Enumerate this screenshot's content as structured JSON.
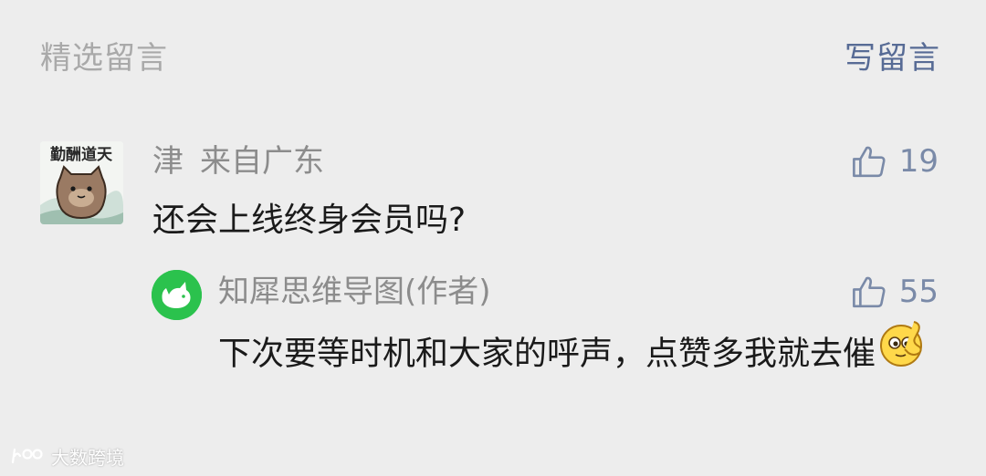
{
  "header": {
    "title": "精选留言",
    "write_label": "写留言"
  },
  "comment": {
    "avatar_caption": "勤酬道天",
    "nickname": "津",
    "location": "来自广东",
    "likes": "19",
    "text": "还会上线终身会员吗?"
  },
  "reply": {
    "nickname": "知犀思维导图(作者)",
    "likes": "55",
    "text": "下次要等时机和大家的呼声，点赞多我就去催"
  },
  "watermark": {
    "text": "大数跨境"
  },
  "colors": {
    "background": "#ededed",
    "link": "#576b95",
    "muted": "#8c8c8c",
    "brand_green": "#2bc24d"
  }
}
